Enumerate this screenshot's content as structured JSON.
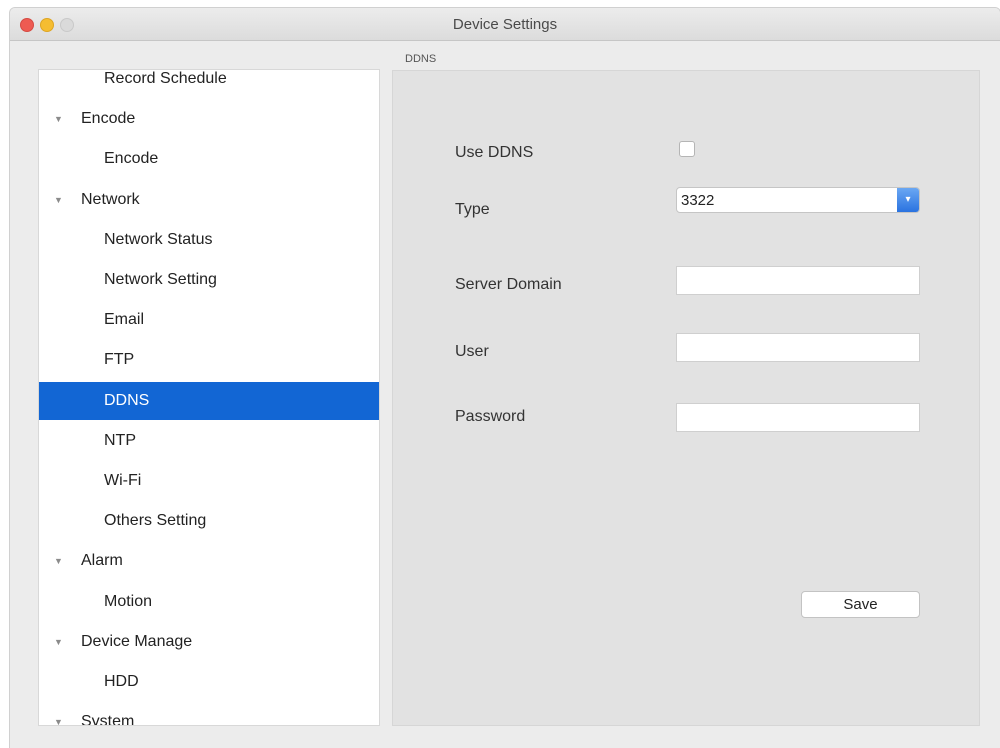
{
  "window": {
    "title": "Device Settings"
  },
  "section_label": "DDNS",
  "sidebar": {
    "items": [
      {
        "label": "Record Schedule",
        "kind": "child"
      },
      {
        "label": "Encode",
        "kind": "group"
      },
      {
        "label": "Encode",
        "kind": "child"
      },
      {
        "label": "Network",
        "kind": "group"
      },
      {
        "label": "Network Status",
        "kind": "child"
      },
      {
        "label": "Network Setting",
        "kind": "child"
      },
      {
        "label": "Email",
        "kind": "child"
      },
      {
        "label": "FTP",
        "kind": "child"
      },
      {
        "label": "DDNS",
        "kind": "child",
        "selected": true
      },
      {
        "label": "NTP",
        "kind": "child"
      },
      {
        "label": "Wi-Fi",
        "kind": "child"
      },
      {
        "label": "Others Setting",
        "kind": "child"
      },
      {
        "label": "Alarm",
        "kind": "group"
      },
      {
        "label": "Motion",
        "kind": "child"
      },
      {
        "label": "Device Manage",
        "kind": "group"
      },
      {
        "label": "HDD",
        "kind": "child"
      },
      {
        "label": "System",
        "kind": "group"
      }
    ],
    "expand_icon": "disclosure-triangle-down-icon"
  },
  "form": {
    "use_ddns": {
      "label": "Use DDNS",
      "checked": false
    },
    "type": {
      "label": "Type",
      "value": "3322"
    },
    "server_domain": {
      "label": "Server Domain",
      "value": ""
    },
    "user": {
      "label": "User",
      "value": ""
    },
    "password": {
      "label": "Password",
      "value": ""
    },
    "save_label": "Save"
  },
  "colors": {
    "selection": "#1266d4",
    "panel_bg": "#e2e2e2",
    "close": "#ee5b52",
    "minimize": "#f5bd31"
  }
}
